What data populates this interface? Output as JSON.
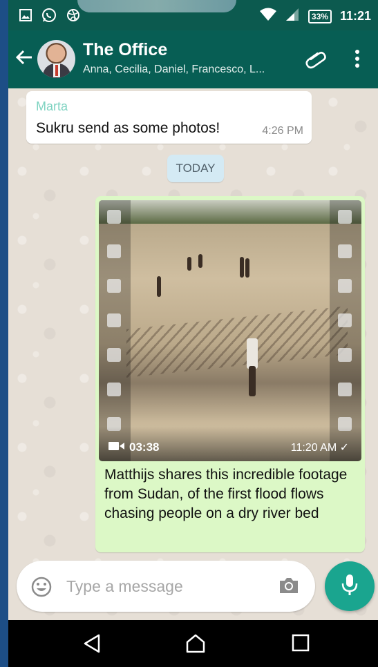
{
  "status_bar": {
    "battery": "33%",
    "time": "11:21"
  },
  "header": {
    "title": "The Office",
    "subtitle": "Anna, Cecilia, Daniel, Francesco, L..."
  },
  "messages": {
    "incoming": {
      "sender": "Marta",
      "text": "Sukru send as some photos!",
      "time": "4:26 PM"
    },
    "date_separator": "TODAY",
    "outgoing": {
      "video_duration": "03:38",
      "time": "11:20 AM ✓",
      "caption": "Matthijs shares this incredible footage from Sudan, of the first flood flows chasing people on a dry river bed"
    }
  },
  "composer": {
    "placeholder": "Type a message"
  },
  "colors": {
    "header": "#075e54",
    "accent": "#1aa58f",
    "outgoing_bubble": "#dcf8c6",
    "sender_name": "#7ed3c1"
  },
  "icons": [
    "image-icon",
    "whatsapp-icon",
    "dribbble-icon",
    "wifi-icon",
    "signal-icon",
    "battery-icon",
    "back-arrow-icon",
    "paperclip-icon",
    "more-vert-icon",
    "video-camera-icon",
    "emoji-icon",
    "camera-icon",
    "microphone-icon",
    "nav-back-icon",
    "nav-home-icon",
    "nav-recents-icon"
  ]
}
